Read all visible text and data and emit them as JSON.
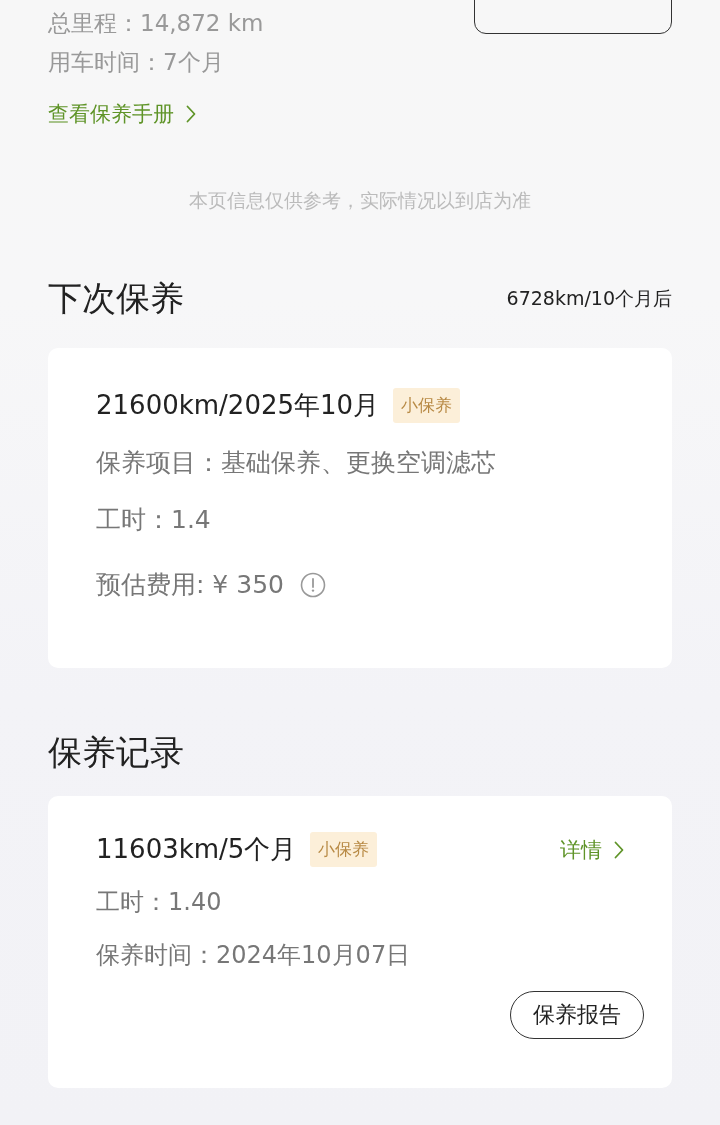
{
  "summary": {
    "mileage": "总里程：14,872 km",
    "usage_time": "用车时间：7个月",
    "manual_link": "查看保养手册"
  },
  "notice": "本页信息仅供参考，实际情况以到店为准",
  "next_maintenance": {
    "title": "下次保养",
    "remaining": "6728km/10个月后",
    "card": {
      "heading": "21600km/2025年10月",
      "tag": "小保养",
      "items": "保养项目：基础保养、更换空调滤芯",
      "hours": "工时：1.4",
      "cost": "预估费用: ¥ 350"
    }
  },
  "records": {
    "title": "保养记录",
    "entries": [
      {
        "heading": "11603km/5个月",
        "tag": "小保养",
        "detail_link": "详情",
        "hours": "工时：1.40",
        "date": "保养时间：2024年10月07日",
        "report_button": "保养报告"
      }
    ]
  }
}
